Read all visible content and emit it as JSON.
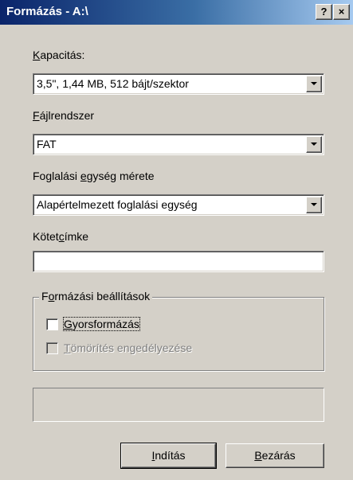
{
  "window": {
    "title": "Formázás - A:\\",
    "help_glyph": "?",
    "close_glyph": "×"
  },
  "capacity": {
    "label_accel": "K",
    "label_rest": "apacitás:",
    "value": "3,5\",  1,44 MB, 512 bájt/szektor"
  },
  "filesystem": {
    "label_accel": "F",
    "label_rest": "ájlrendszer",
    "value": "FAT"
  },
  "allocation": {
    "label_pre": "Foglalási ",
    "label_accel": "e",
    "label_rest": "gység mérete",
    "value": "Alapértelmezett foglalási egység"
  },
  "volume_label": {
    "label_pre": "Kötet",
    "label_accel": "c",
    "label_rest": "ímke",
    "value": ""
  },
  "format_options": {
    "title_pre": "F",
    "title_accel": "o",
    "title_rest": "rmázási beállítások",
    "quick_format": {
      "label_accel": "G",
      "label_rest": "yorsformázás",
      "checked": false
    },
    "compression": {
      "label_accel": "T",
      "label_rest": "ömörítés engedélyezése",
      "checked": false,
      "enabled": false
    }
  },
  "progress": {
    "value": 0
  },
  "buttons": {
    "start": {
      "label_accel": "I",
      "label_rest": "ndítás"
    },
    "close": {
      "label_accel": "B",
      "label_rest": "ezárás"
    }
  }
}
